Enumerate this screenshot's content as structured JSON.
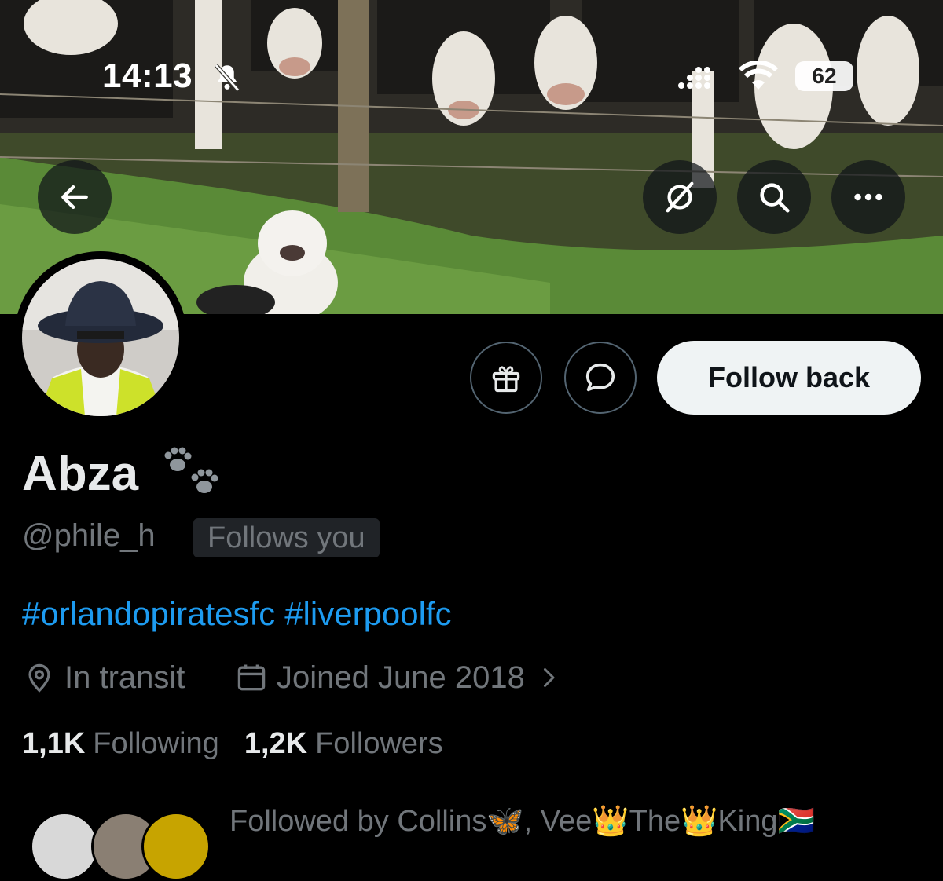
{
  "status_bar": {
    "time": "14:13",
    "battery": "62",
    "icons": [
      "bell-muted-icon",
      "cellular-signal-icon",
      "wifi-icon",
      "battery-icon"
    ]
  },
  "banner": {
    "description_icons": [
      "back-arrow-icon",
      "grok-icon",
      "search-icon",
      "more-icon"
    ]
  },
  "profile": {
    "name": "Abza",
    "name_emoji": "🐾",
    "handle": "@phile_h",
    "follows_you_badge": "Follows you",
    "bio_hashtags": [
      "#orlandopiratesfc",
      "#liverpoolfc"
    ],
    "location": "In transit",
    "joined": "Joined June 2018",
    "following_count": "1,1K",
    "following_label": "Following",
    "followers_count": "1,2K",
    "followers_label": "Followers",
    "followed_by": "Followed by Collins🦋, Vee👑The👑King🇿🇦"
  },
  "actions": {
    "follow_back_label": "Follow back",
    "gift_icon": "gift-icon",
    "message_icon": "message-icon"
  },
  "colors": {
    "background": "#000000",
    "primary_text": "#e7e9ea",
    "secondary_text": "#71767b",
    "link": "#1d9bf0",
    "button_bg": "#eff3f4",
    "badge_bg": "#202327",
    "border": "#536471"
  }
}
